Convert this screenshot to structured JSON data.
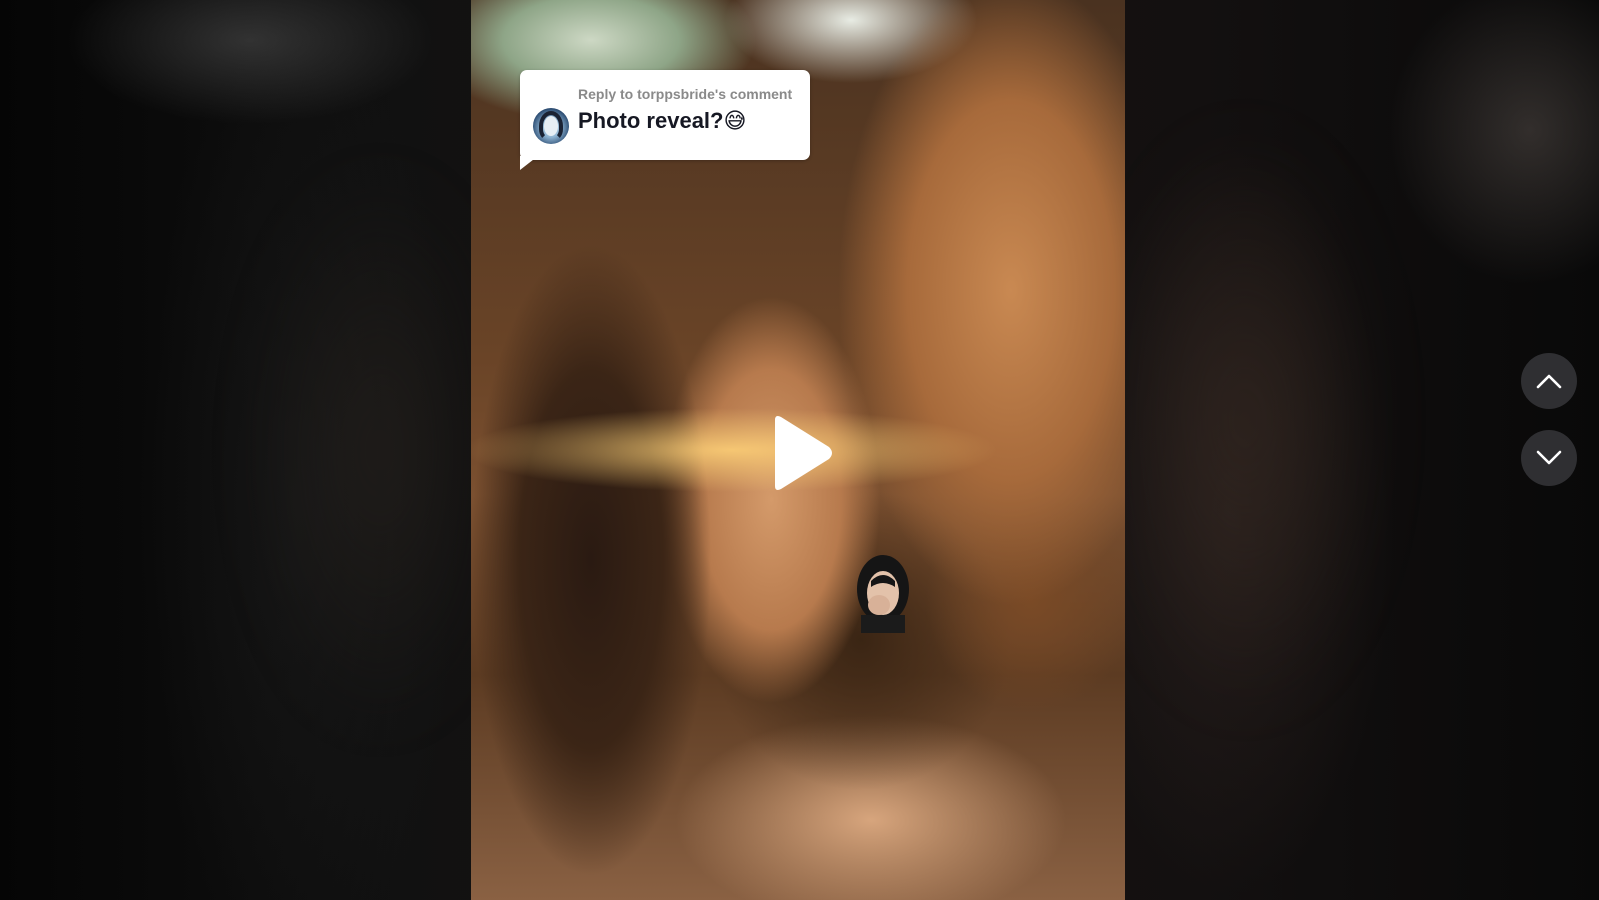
{
  "video": {
    "reply_sticker": {
      "label": "Reply to torppsbride's comment",
      "comment_text": "Photo reveal?",
      "comment_emoji": "😅",
      "avatar_icon": "user-avatar"
    },
    "play_icon": "play-icon",
    "overlay_icon": "creator-greenscreen-overlay"
  },
  "navigation": {
    "up_icon": "chevron-up-icon",
    "down_icon": "chevron-down-icon"
  },
  "colors": {
    "background": "#0b0b0b",
    "sticker_bg": "#ffffff",
    "sticker_label": "#8a8a8a",
    "sticker_text": "#161823",
    "nav_button_bg": "#2f2f32",
    "play_icon": "#ffffff"
  }
}
